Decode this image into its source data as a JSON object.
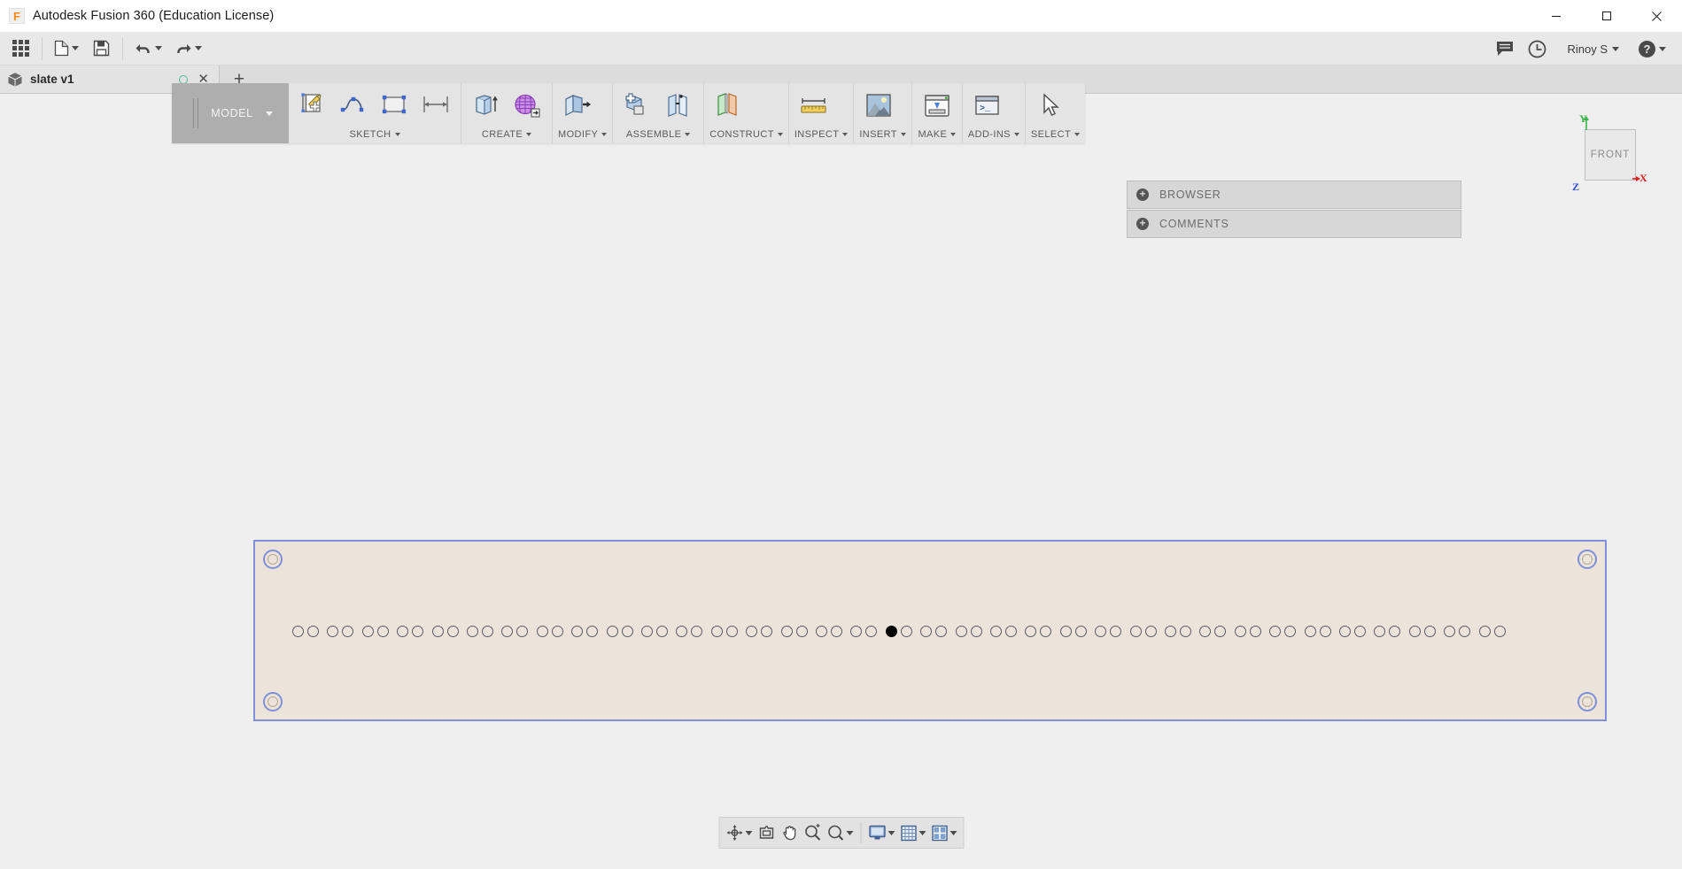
{
  "window": {
    "title": "Autodesk Fusion 360 (Education License)",
    "logo_glyph": "F",
    "controls": {
      "minimize": "—",
      "maximize": "☐",
      "close": "✕"
    }
  },
  "quick_access": {
    "items": [
      {
        "name": "app-grid",
        "icon": "grid-icon",
        "label": ""
      },
      {
        "name": "new-file",
        "icon": "file-icon",
        "label": "",
        "has_caret": true
      },
      {
        "name": "save",
        "icon": "save-icon",
        "label": ""
      },
      {
        "name": "undo",
        "icon": "undo-icon",
        "label": "",
        "has_caret": true
      },
      {
        "name": "redo",
        "icon": "redo-icon",
        "label": "",
        "has_caret": true
      }
    ],
    "right": {
      "comments_icon": "comment-icon",
      "history_icon": "clock-icon",
      "user_name": "Rinoy S",
      "help_icon": "help-icon"
    }
  },
  "tabs": {
    "document": {
      "icon": "cube-icon",
      "label": "slate v1",
      "unsaved_indicator": true,
      "close_glyph": "✕"
    },
    "new_tab_glyph": "+"
  },
  "ribbon": {
    "workspace": {
      "label": "MODEL",
      "has_caret": true
    },
    "panels": [
      {
        "label": "SKETCH",
        "has_caret": true,
        "tools": [
          "create-sketch-icon",
          "spline-icon",
          "rectangle-icon",
          "dimension-icon"
        ]
      },
      {
        "label": "CREATE",
        "has_caret": true,
        "tools": [
          "extrude-icon",
          "form-icon"
        ]
      },
      {
        "label": "MODIFY",
        "has_caret": true,
        "tools": [
          "press-pull-icon"
        ]
      },
      {
        "label": "ASSEMBLE",
        "has_caret": true,
        "tools": [
          "new-component-icon",
          "joint-icon"
        ]
      },
      {
        "label": "CONSTRUCT",
        "has_caret": true,
        "tools": [
          "offset-plane-icon"
        ]
      },
      {
        "label": "INSPECT",
        "has_caret": true,
        "tools": [
          "measure-icon"
        ]
      },
      {
        "label": "INSERT",
        "has_caret": true,
        "tools": [
          "insert-image-icon"
        ]
      },
      {
        "label": "MAKE",
        "has_caret": true,
        "tools": [
          "3d-print-icon"
        ]
      },
      {
        "label": "ADD-INS",
        "has_caret": true,
        "tools": [
          "scripts-addins-icon"
        ]
      },
      {
        "label": "SELECT",
        "has_caret": true,
        "tools": [
          "select-icon"
        ]
      }
    ]
  },
  "flyout": {
    "rows": [
      {
        "expand_glyph": "+",
        "label": "BROWSER"
      },
      {
        "expand_glyph": "+",
        "label": "COMMENTS"
      }
    ]
  },
  "viewcube": {
    "face_label": "FRONT",
    "axes": [
      {
        "label": "Y",
        "color": "#39b54a"
      },
      {
        "label": "Z",
        "color": "#2f4fd6"
      },
      {
        "label": "X",
        "color": "#e02020"
      }
    ]
  },
  "model": {
    "name": "slate",
    "body_color": "#ece4da",
    "selection_color": "#7f90d8",
    "hole_color": "#5c5c66",
    "selected_hole_color": "#000000",
    "corner_counterbores": 4,
    "hole_pair_count": 35,
    "selected_hole_index": 35,
    "total_holes": 70
  },
  "navbar": {
    "items": [
      {
        "name": "orbit",
        "icon": "orbit-icon",
        "has_caret": true
      },
      {
        "name": "look-at",
        "icon": "look-at-icon",
        "has_caret": false
      },
      {
        "name": "pan",
        "icon": "pan-icon",
        "has_caret": false
      },
      {
        "name": "zoom",
        "icon": "zoom-icon",
        "has_caret": false
      },
      {
        "name": "fit",
        "icon": "fit-icon",
        "has_caret": true
      },
      {
        "name": "display-settings",
        "icon": "display-settings-icon",
        "has_caret": true
      },
      {
        "name": "grid-snaps",
        "icon": "grid-snaps-icon",
        "has_caret": true
      },
      {
        "name": "viewports",
        "icon": "viewports-icon",
        "has_caret": true
      }
    ],
    "separator_after_index": 4
  }
}
